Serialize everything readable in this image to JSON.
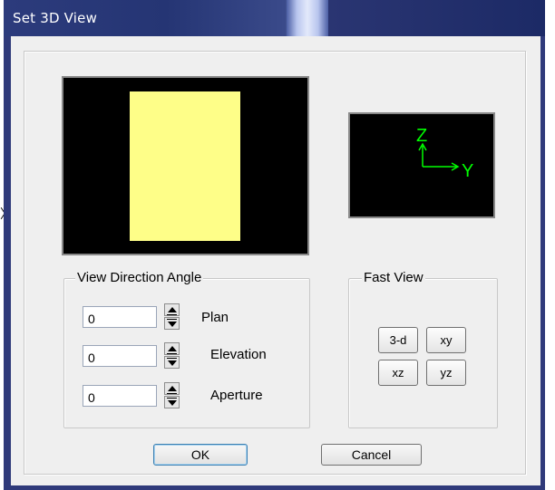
{
  "window": {
    "title": "Set 3D View"
  },
  "axes": {
    "z_label": "Z",
    "y_label": "Y",
    "color": "#00ff00"
  },
  "preview": {
    "background": "#000000",
    "object_color": "#fefe88"
  },
  "view_direction": {
    "group_label": "View Direction Angle",
    "fields": [
      {
        "label": "Plan",
        "value": "0"
      },
      {
        "label": "Elevation",
        "value": "0"
      },
      {
        "label": "Aperture",
        "value": "0"
      }
    ]
  },
  "fast_view": {
    "group_label": "Fast View",
    "buttons": [
      "3-d",
      "xy",
      "xz",
      "yz"
    ]
  },
  "buttons": {
    "ok": "OK",
    "cancel": "Cancel"
  },
  "edge_glyph": "〉"
}
